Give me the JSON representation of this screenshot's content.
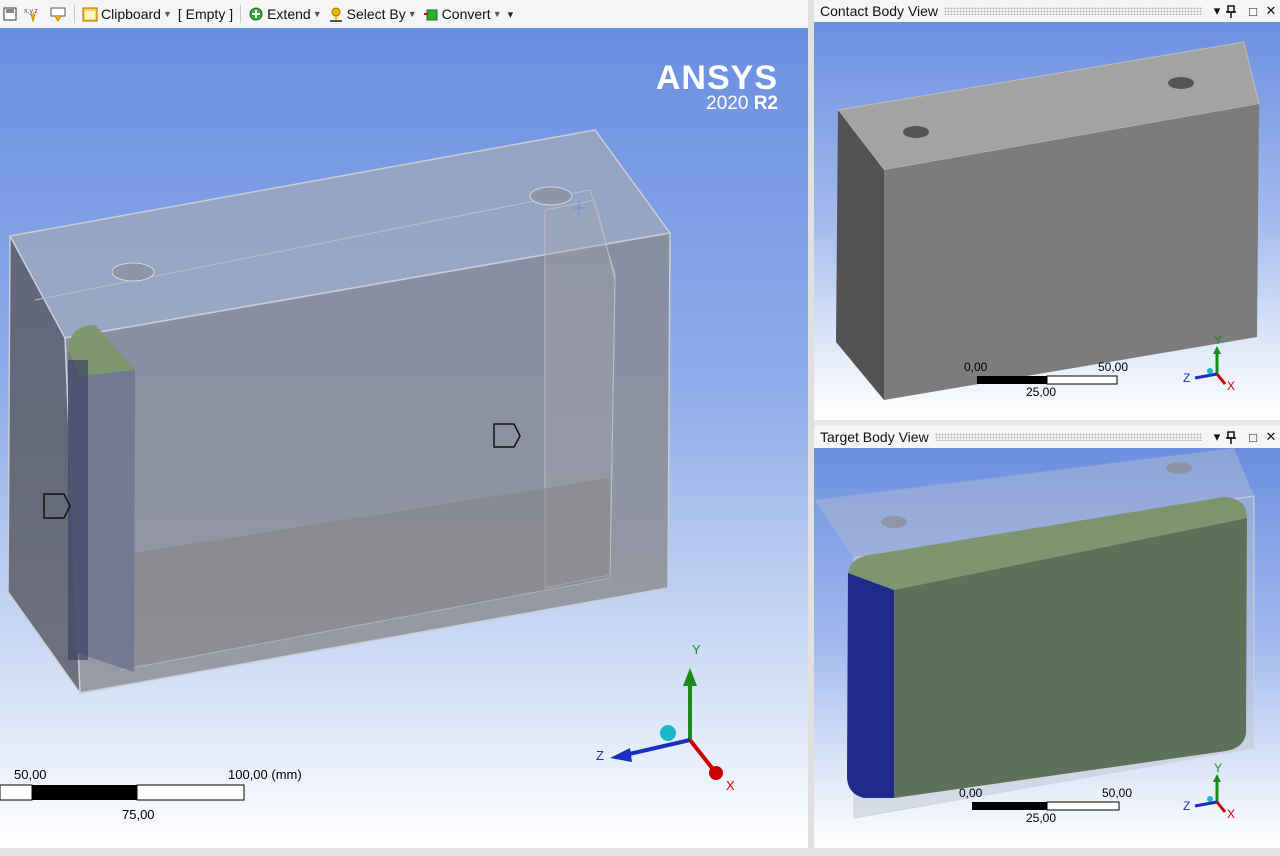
{
  "toolbar": {
    "clipboard_label": "Clipboard",
    "empty_label": "[ Empty ]",
    "extend_label": "Extend",
    "select_by_label": "Select By",
    "convert_label": "Convert",
    "icons": [
      "save-icon",
      "xyz-icon",
      "label-icon",
      "clipboard-icon",
      "extend-icon",
      "select-by-icon",
      "convert-icon",
      "overflow-icon"
    ]
  },
  "main_view": {
    "logo_brand": "ANSYS",
    "logo_version": "2020",
    "logo_release": "R2",
    "scale_left": "50,00",
    "scale_right": "100,00 (mm)",
    "scale_mid": "75,00",
    "triad": {
      "x": "X",
      "y": "Y",
      "z": "Z"
    }
  },
  "contact_panel": {
    "title": "Contact Body View",
    "scale_left": "0,00",
    "scale_right": "50,00",
    "scale_mid": "25,00",
    "triad": {
      "x": "X",
      "y": "Y",
      "z": "Z"
    }
  },
  "target_panel": {
    "title": "Target Body View",
    "scale_left": "0,00",
    "scale_right": "50,00",
    "scale_mid": "25,00",
    "triad": {
      "x": "X",
      "y": "Y",
      "z": "Z"
    }
  },
  "panel_controls": {
    "dropdown": "▾",
    "pin": "ᛘ",
    "maximize": "□",
    "close": "✕"
  },
  "colors": {
    "viewport_top": "#6b8ee0",
    "contact_face": "#5f7858",
    "contact_side": "#1f2a8a",
    "x_axis": "#cc0000",
    "y_axis": "#1a8a1a",
    "z_axis": "#1830c0"
  }
}
